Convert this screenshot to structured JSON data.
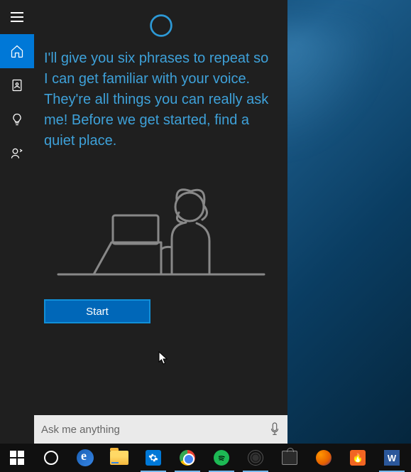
{
  "cortana": {
    "instruction": "I'll give you six phrases to repeat so I can get familiar with your voice. They're all things you can really ask me! Before we get started, find a quiet place.",
    "start_label": "Start",
    "search_placeholder": "Ask me anything"
  },
  "rail": {
    "items": [
      "menu",
      "home",
      "notebook",
      "tips",
      "feedback"
    ]
  },
  "taskbar": {
    "items": [
      {
        "name": "start",
        "running": false
      },
      {
        "name": "cortana",
        "running": false
      },
      {
        "name": "edge",
        "running": false
      },
      {
        "name": "file-explorer",
        "running": false
      },
      {
        "name": "settings",
        "running": true
      },
      {
        "name": "chrome",
        "running": true
      },
      {
        "name": "spotify",
        "running": true
      },
      {
        "name": "obs",
        "running": true
      },
      {
        "name": "store",
        "running": false
      },
      {
        "name": "firefox",
        "running": false
      },
      {
        "name": "curse",
        "running": false
      },
      {
        "name": "word",
        "running": true
      }
    ]
  },
  "colors": {
    "accent": "#0078d7",
    "link_text": "#3ea1d9",
    "panel_bg": "#1f1f1f"
  }
}
